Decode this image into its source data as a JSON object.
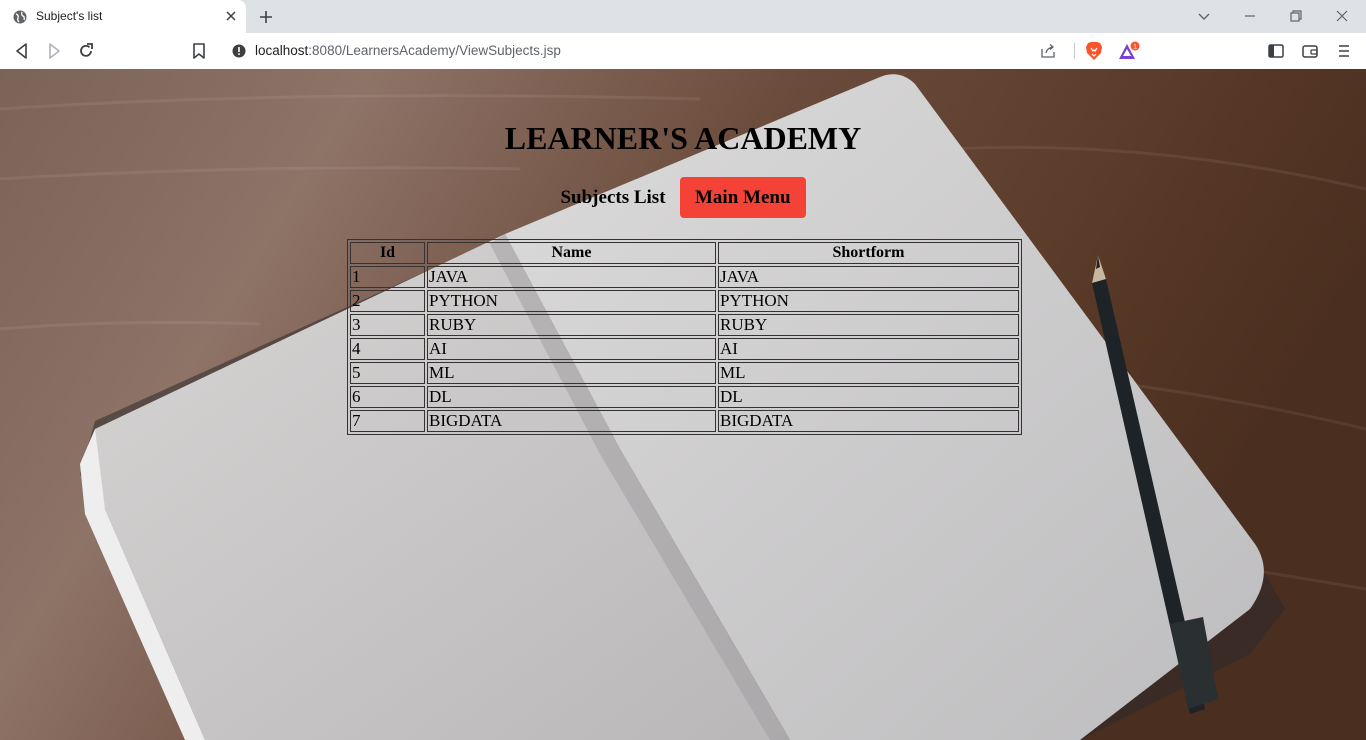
{
  "browser": {
    "tab_title": "Subject's list",
    "url_host": "localhost",
    "url_rest": ":8080/LearnersAcademy/ViewSubjects.jsp",
    "rewards_badge": "1"
  },
  "page": {
    "heading": "LEARNER'S ACADEMY",
    "subnav_label": "Subjects List",
    "main_menu_button": "Main Menu"
  },
  "table": {
    "headers": [
      "Id",
      "Name",
      "Shortform"
    ],
    "rows": [
      [
        "1",
        "JAVA",
        "JAVA"
      ],
      [
        "2",
        "PYTHON",
        "PYTHON"
      ],
      [
        "3",
        "RUBY",
        "RUBY"
      ],
      [
        "4",
        "AI",
        "AI"
      ],
      [
        "5",
        "ML",
        "ML"
      ],
      [
        "6",
        "DL",
        "DL"
      ],
      [
        "7",
        "BIGDATA",
        "BIGDATA"
      ]
    ]
  },
  "colors": {
    "main_menu_button": "#f44336",
    "brave_orange": "#fb542b"
  }
}
